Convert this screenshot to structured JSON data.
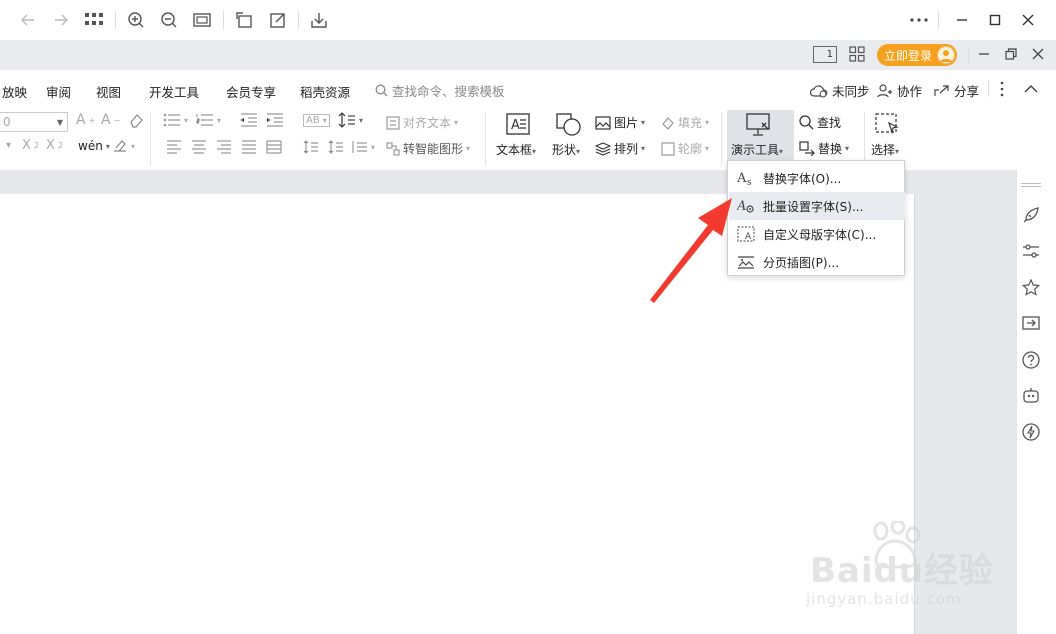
{
  "titlebar": {
    "icons": [
      "back-icon",
      "forward-icon",
      "apps-grid-icon",
      "zoom-in-icon",
      "zoom-out-icon",
      "fit-window-icon",
      "rotate-icon",
      "edit-icon",
      "download-icon",
      "more-icon",
      "minimize-icon",
      "maximize-icon",
      "close-icon"
    ]
  },
  "accountbar": {
    "page_indicator": "1",
    "login_label": "立即登录"
  },
  "menu": {
    "tabs": [
      "放映",
      "审阅",
      "视图",
      "开发工具",
      "会员专享",
      "稻壳资源"
    ],
    "search_placeholder": "查找命令、搜索模板",
    "sync_label": "未同步",
    "collab_label": "协作",
    "share_label": "分享"
  },
  "ribbon": {
    "font_size_value": "0",
    "align_text": "对齐文本",
    "smart_shape": "转智能图形",
    "textbox": "文本框",
    "shape": "形状",
    "picture": "图片",
    "arrange": "排列",
    "fill": "填充",
    "outline": "轮廓",
    "demo_tools": "演示工具",
    "find": "查找",
    "replace": "替换",
    "select": "选择"
  },
  "dropdown": {
    "items": [
      {
        "label": "替换字体(O)...",
        "icon": "replace-font-icon"
      },
      {
        "label": "批量设置字体(S)...",
        "icon": "batch-font-icon"
      },
      {
        "label": "自定义母版字体(C)...",
        "icon": "master-font-icon"
      },
      {
        "label": "分页插图(P)...",
        "icon": "paged-image-icon"
      }
    ]
  },
  "sidepane": {
    "icons": [
      "rocket-icon",
      "sliders-icon",
      "star-icon",
      "screen-share-icon",
      "help-icon",
      "robot-icon",
      "bolt-icon"
    ]
  },
  "watermark": {
    "main": "Baidu经验",
    "sub": "jingyan.baidu.com"
  },
  "colors": {
    "accent": "#f6a11e",
    "arrow": "#f23a2e",
    "hover": "#e8ebf0"
  }
}
